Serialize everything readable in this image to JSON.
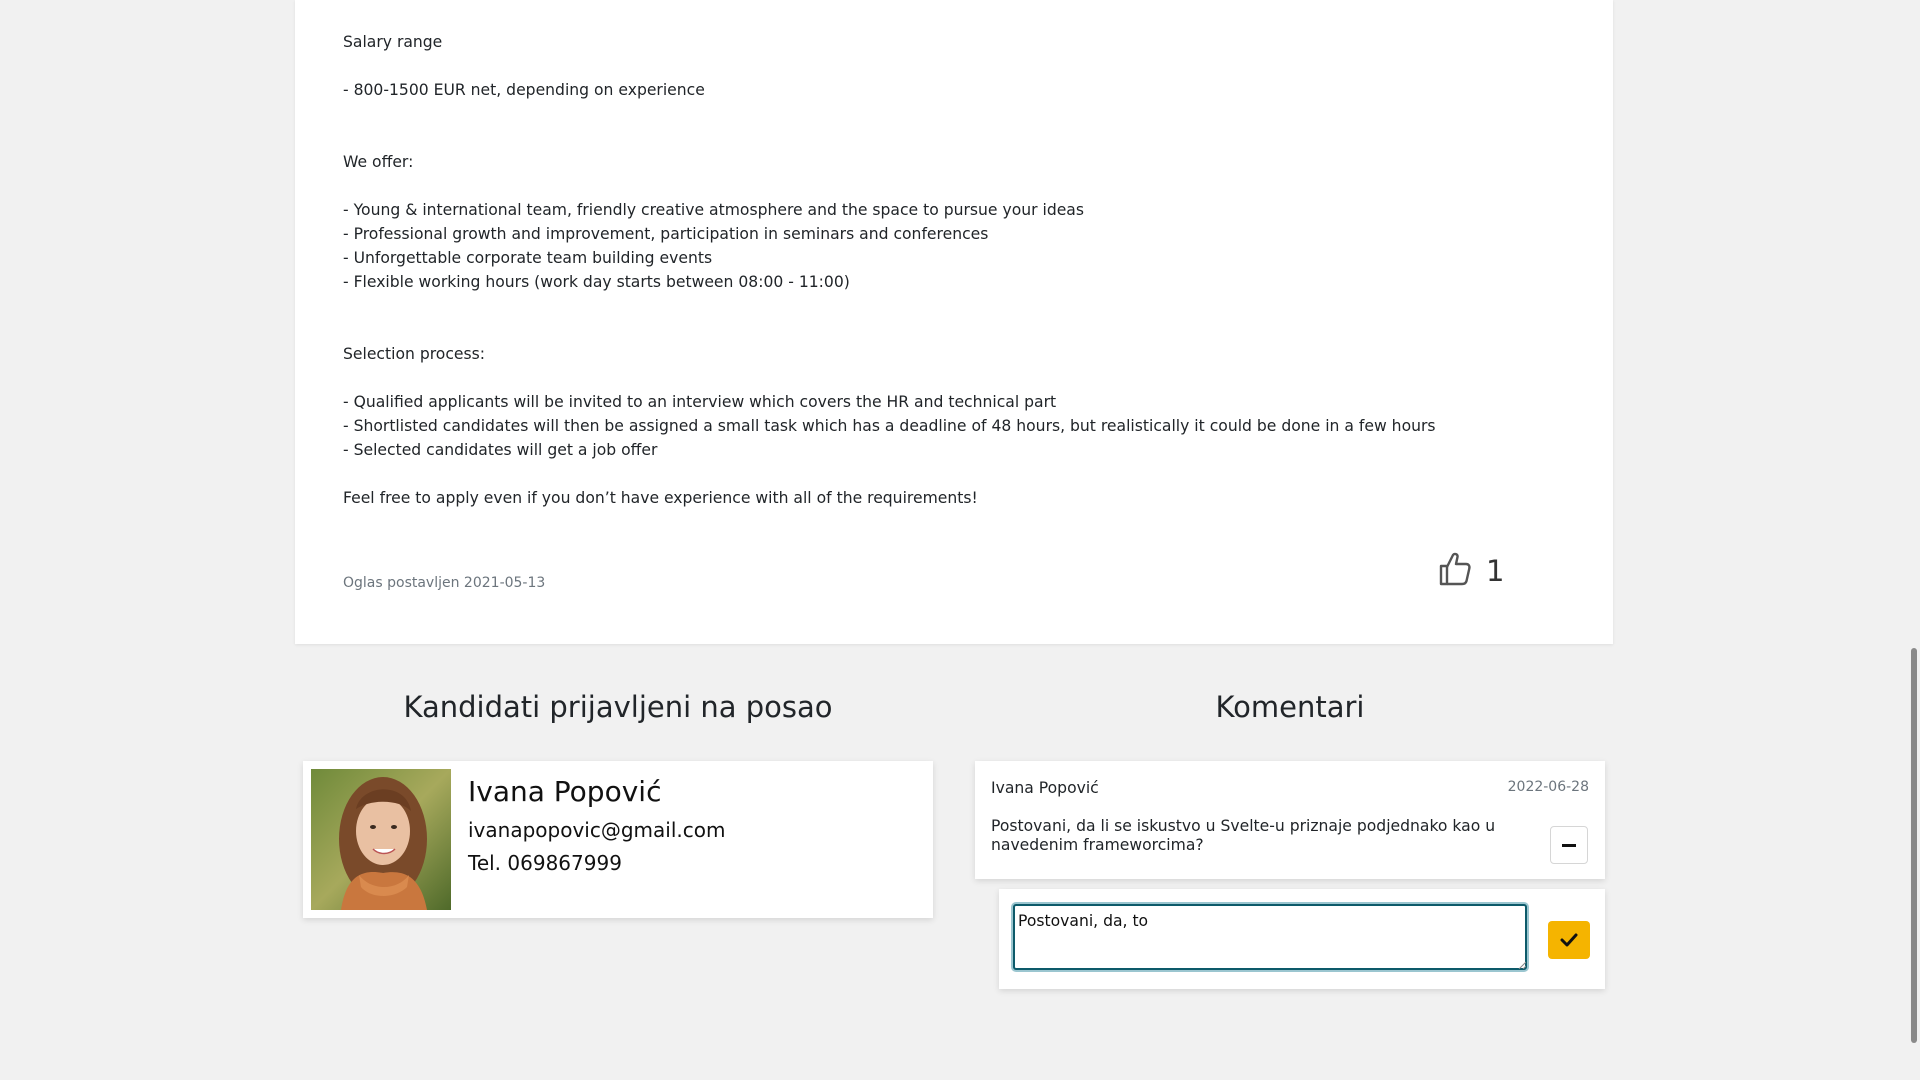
{
  "job": {
    "description": {
      "salary_heading": "Salary range",
      "salary_line": "- 800-1500 EUR net, depending on experience",
      "offer_heading": "We offer:",
      "offer_items": [
        "- Young & international team, friendly creative atmosphere and the space to pursue your ideas",
        "- Professional growth and improvement, participation in seminars and conferences",
        "- Unforgettable corporate team building events",
        "- Flexible working hours (work day starts between 08:00 - 11:00)"
      ],
      "selection_heading": "Selection process:",
      "selection_items": [
        "- Qualified applicants will be invited to an interview which covers the HR and technical part",
        "- Shortlisted candidates will then be assigned a small task which has a deadline of 48 hours, but realistically it could be done in a few hours",
        "- Selected candidates will get a job offer"
      ],
      "closing": "Feel free to apply even if you don’t have experience with all of the requirements!"
    },
    "posted": "Oglas postavljen 2021-05-13",
    "likes": "1",
    "like_icon": "thumbs-up-icon"
  },
  "candidates": {
    "title": "Kandidati prijavljeni na posao",
    "items": [
      {
        "name": "Ivana Popović",
        "email": "ivanapopovic@gmail.com",
        "phone": "Tel. 069867999"
      }
    ]
  },
  "comments": {
    "title": "Komentari",
    "items": [
      {
        "author": "Ivana Popović",
        "date": "2022-06-28",
        "text": "Postovani, da li se iskustvo u Svelte-u priznaje podjednako kao u navedenim frameworcima?"
      }
    ],
    "reply_value": "Postovani, da, to",
    "colors": {
      "accent": "#f5b400",
      "focus": "#0d5a6a"
    }
  }
}
